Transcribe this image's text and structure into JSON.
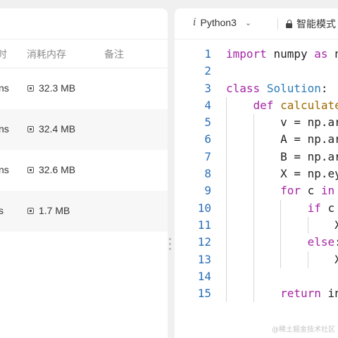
{
  "table": {
    "headers": {
      "time": "时",
      "memory": "消耗内存",
      "notes": "备注"
    },
    "rows": [
      {
        "time": "ns",
        "memory": "32.3 MB",
        "notes": ""
      },
      {
        "time": "ns",
        "memory": "32.4 MB",
        "notes": ""
      },
      {
        "time": "ns",
        "memory": "32.6 MB",
        "notes": ""
      },
      {
        "time": "s",
        "memory": "1.7 MB",
        "notes": ""
      }
    ]
  },
  "editor": {
    "language": "Python3",
    "mode": "智能模式",
    "lines": [
      {
        "n": "1",
        "indent": "",
        "tokens": [
          [
            "kw",
            "import"
          ],
          [
            "",
            "numpy"
          ],
          [
            "kw",
            "as"
          ],
          [
            "",
            "n"
          ]
        ]
      },
      {
        "n": "2",
        "indent": "",
        "tokens": []
      },
      {
        "n": "3",
        "indent": "",
        "tokens": [
          [
            "kw",
            "class"
          ],
          [
            "cl",
            "Solution"
          ],
          [
            "",
            ":"
          ]
        ]
      },
      {
        "n": "4",
        "indent": "    ",
        "tokens": [
          [
            "kw",
            "def"
          ],
          [
            "fn",
            "calculate"
          ]
        ]
      },
      {
        "n": "5",
        "indent": "        ",
        "tokens": [
          [
            "",
            "v = np.ar"
          ]
        ]
      },
      {
        "n": "6",
        "indent": "        ",
        "tokens": [
          [
            "",
            "A = np.ar"
          ]
        ]
      },
      {
        "n": "7",
        "indent": "        ",
        "tokens": [
          [
            "",
            "B = np.ar"
          ]
        ]
      },
      {
        "n": "8",
        "indent": "        ",
        "tokens": [
          [
            "",
            "X = np.ey"
          ]
        ]
      },
      {
        "n": "9",
        "indent": "        ",
        "tokens": [
          [
            "kw",
            "for"
          ],
          [
            "",
            "c"
          ],
          [
            "kw",
            "in"
          ]
        ]
      },
      {
        "n": "10",
        "indent": "            ",
        "tokens": [
          [
            "kw",
            "if"
          ],
          [
            "",
            "c"
          ]
        ]
      },
      {
        "n": "11",
        "indent": "                ",
        "tokens": [
          [
            "",
            "X"
          ]
        ]
      },
      {
        "n": "12",
        "indent": "            ",
        "tokens": [
          [
            "kw",
            "else"
          ],
          [
            "",
            ":"
          ]
        ]
      },
      {
        "n": "13",
        "indent": "                ",
        "tokens": [
          [
            "",
            "X"
          ]
        ]
      },
      {
        "n": "14",
        "indent": "",
        "tokens": []
      },
      {
        "n": "15",
        "indent": "        ",
        "tokens": [
          [
            "kw",
            "return"
          ],
          [
            "",
            "in"
          ]
        ]
      }
    ]
  },
  "watermark": "@稀土掘金技术社区",
  "colors": {
    "line_number": "#2a6fb8",
    "keyword": "#a626a4",
    "class_name": "#2b7bb9",
    "function_name": "#9c6b00"
  }
}
